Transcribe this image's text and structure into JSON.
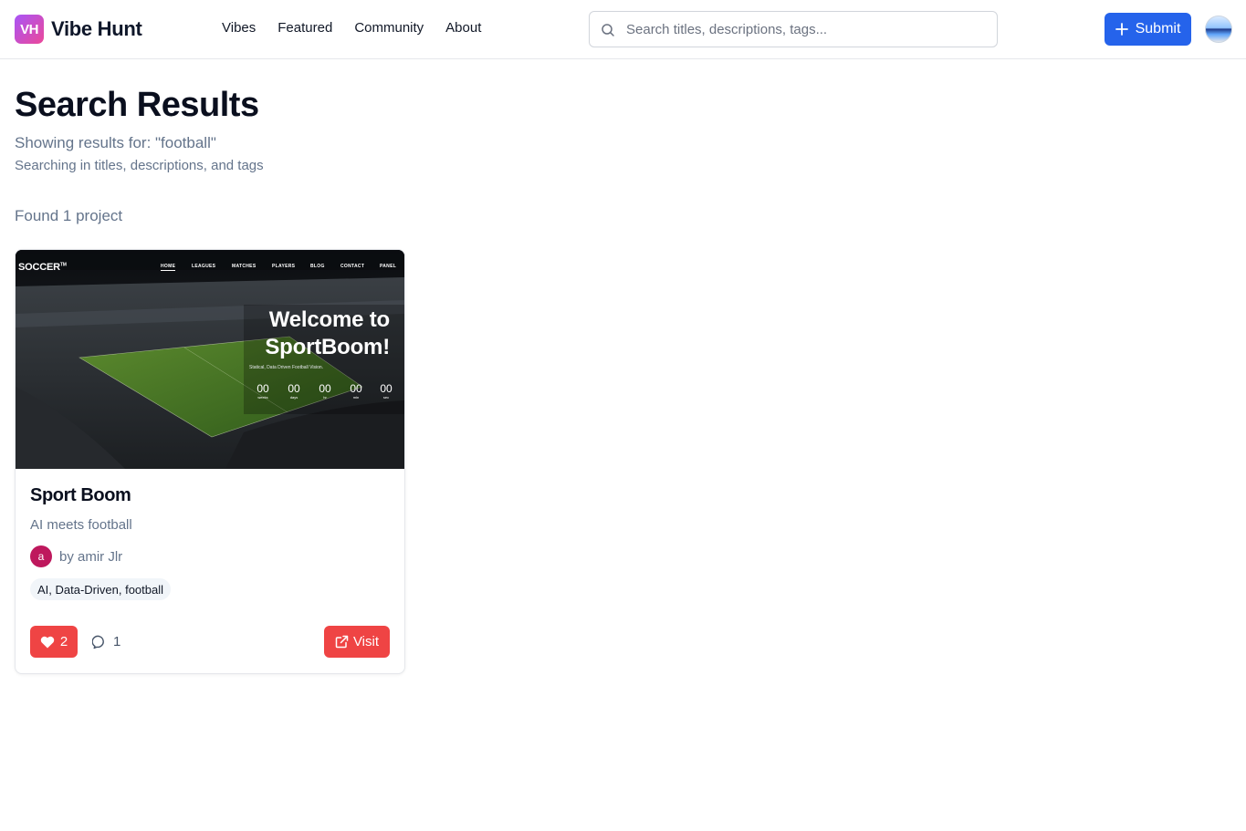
{
  "header": {
    "logo_badge": "VH",
    "logo_text": "Vibe Hunt",
    "nav": [
      "Vibes",
      "Featured",
      "Community",
      "About"
    ],
    "search_placeholder": "Search titles, descriptions, tags...",
    "submit_label": "Submit",
    "accent_color": "#2563eb"
  },
  "page": {
    "title": "Search Results",
    "query_line": "Showing results for: \"football\"",
    "scope_line": "Searching in titles, descriptions, and tags",
    "found_line": "Found 1 project"
  },
  "results": [
    {
      "thumbnail": {
        "brand": "SOCCER",
        "brand_mark": "TM",
        "nav": [
          "HOME",
          "LEAGUES",
          "MATCHES",
          "PLAYERS",
          "BLOG",
          "CONTACT",
          "PANEL"
        ],
        "headline_1": "Welcome to",
        "headline_2": "SportBoom!",
        "tagline": "Statical, Data Driven Football Vision.",
        "countdown": [
          {
            "value": "00",
            "unit": "weeks"
          },
          {
            "value": "00",
            "unit": "days"
          },
          {
            "value": "00",
            "unit": "hr"
          },
          {
            "value": "00",
            "unit": "min"
          },
          {
            "value": "00",
            "unit": "sec"
          }
        ]
      },
      "title": "Sport Boom",
      "description": "AI meets football",
      "author_initial": "a",
      "author": "by amir Jlr",
      "tags": "AI, Data-Driven, football",
      "likes": "2",
      "comments": "1",
      "visit_label": "Visit",
      "like_color": "#ef4444"
    }
  ]
}
